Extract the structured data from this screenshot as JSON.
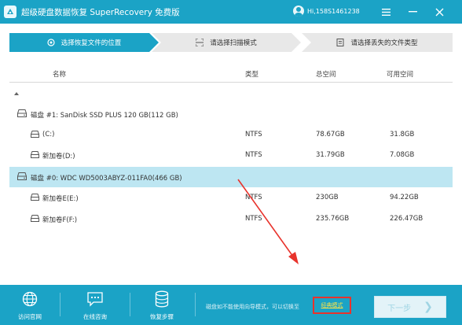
{
  "app": {
    "title": "超级硬盘数据恢复 SuperRecovery 免费版",
    "user": "Hi,158S1461238"
  },
  "window_controls": {
    "menu_icon": "menu-icon",
    "minimize_icon": "minimize-icon",
    "close_icon": "close-icon"
  },
  "steps": [
    {
      "label": "选择恢复文件的位置",
      "active": true,
      "icon": "target-icon"
    },
    {
      "label": "请选择扫描模式",
      "active": false,
      "icon": "scan-icon"
    },
    {
      "label": "请选择丢失的文件类型",
      "active": false,
      "icon": "file-icon"
    }
  ],
  "table": {
    "headers": {
      "name": "名称",
      "type": "类型",
      "total": "总空间",
      "free": "可用空间"
    },
    "rows": [
      {
        "kind": "disk",
        "name": "磁盘 #1: SanDisk SSD PLUS 120 GB(112 GB)",
        "type": "",
        "total": "",
        "free": "",
        "selected": false
      },
      {
        "kind": "volume",
        "name": "(C:)",
        "type": "NTFS",
        "total": "78.67GB",
        "free": "31.8GB",
        "selected": false
      },
      {
        "kind": "volume",
        "name": "新加卷(D:)",
        "type": "NTFS",
        "total": "31.79GB",
        "free": "7.08GB",
        "selected": false
      },
      {
        "kind": "disk",
        "name": "磁盘 #0: WDC WD5003ABYZ-011FA0(466 GB)",
        "type": "",
        "total": "",
        "free": "",
        "selected": true
      },
      {
        "kind": "volume",
        "name": "新加卷E(E:)",
        "type": "NTFS",
        "total": "230GB",
        "free": "94.22GB",
        "selected": false
      },
      {
        "kind": "volume",
        "name": "新加卷F(F:)",
        "type": "NTFS",
        "total": "235.76GB",
        "free": "226.47GB",
        "selected": false
      }
    ]
  },
  "bottom": {
    "items": [
      {
        "label": "访问官网",
        "icon": "globe-icon"
      },
      {
        "label": "在线咨询",
        "icon": "chat-icon"
      },
      {
        "label": "恢复步骤",
        "icon": "database-icon"
      }
    ],
    "hint": "磁盘如不能使用向导模式，可以切换至",
    "link": "经典模式",
    "next": "下一步"
  },
  "colors": {
    "primary": "#1ba3c6",
    "selected_row": "#bde6f2",
    "annotation": "#e8332c",
    "link": "#f7e14a"
  }
}
